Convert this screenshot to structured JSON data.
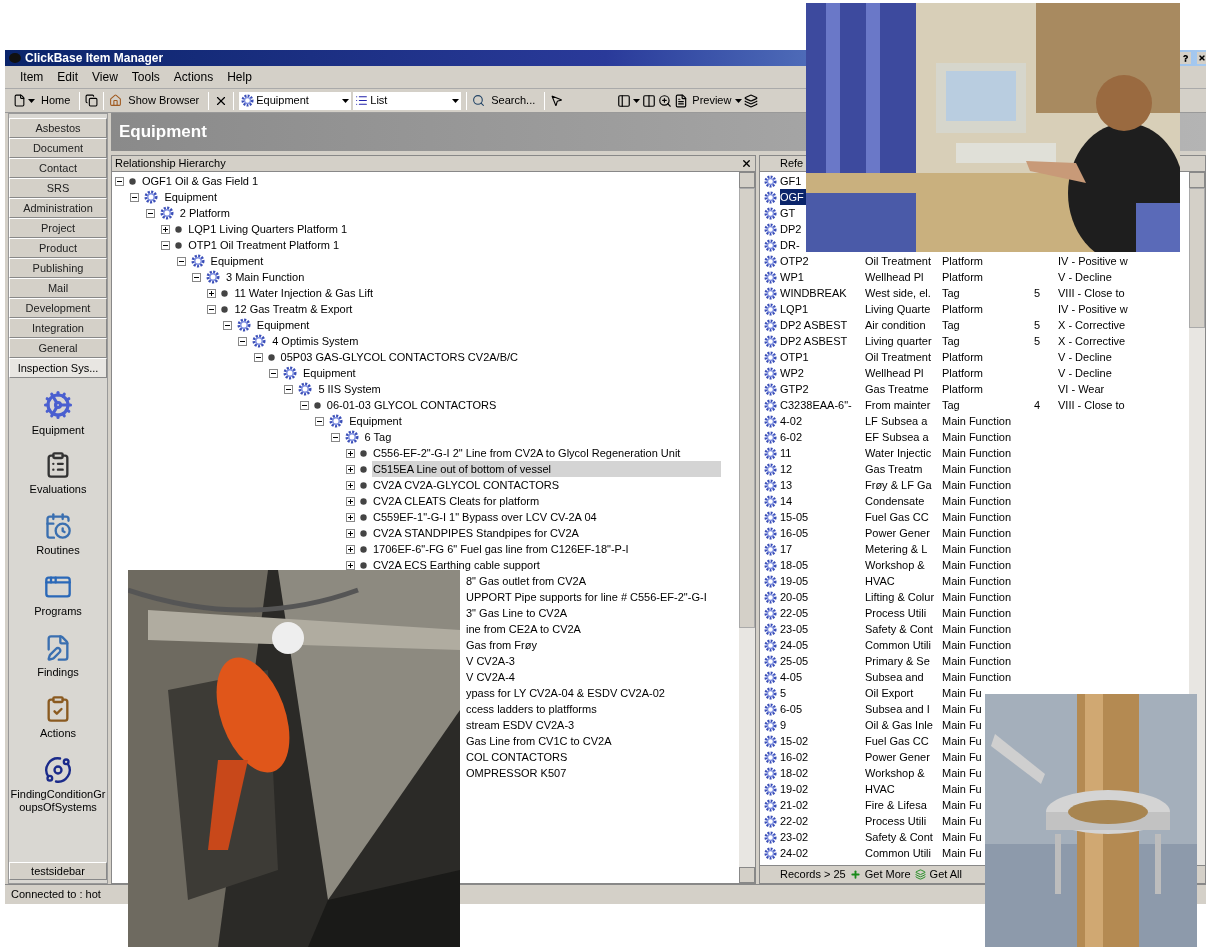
{
  "window": {
    "title": "ClickBase Item Manager"
  },
  "menu": [
    "Item",
    "Edit",
    "View",
    "Tools",
    "Actions",
    "Help"
  ],
  "toolbar": {
    "home": "Home",
    "show_browser": "Show Browser",
    "object_type": "Equipment",
    "view_mode": "List",
    "search": "Search...",
    "preview": "Preview"
  },
  "sidebar": {
    "categories": [
      {
        "label": "Asbestos",
        "selected": false
      },
      {
        "label": "Document",
        "selected": false
      },
      {
        "label": "Contact",
        "selected": false
      },
      {
        "label": "SRS",
        "selected": false
      },
      {
        "label": "Administration",
        "selected": false
      },
      {
        "label": "Project",
        "selected": false
      },
      {
        "label": "Product",
        "selected": false
      },
      {
        "label": "Publishing",
        "selected": false
      },
      {
        "label": "Mail",
        "selected": false
      },
      {
        "label": "Development",
        "selected": false
      },
      {
        "label": "Integration",
        "selected": false
      },
      {
        "label": "General",
        "selected": false
      },
      {
        "label": "Inspection Sys...",
        "selected": true
      }
    ],
    "items": [
      "Equipment",
      "Evaluations",
      "Routines",
      "Programs",
      "Findings",
      "Actions",
      "FindingConditionGroupsOfSystems"
    ],
    "footer": "testsidebar"
  },
  "header": "Equipment",
  "hierarchy": {
    "title": "Relationship Hierarchy",
    "tree": [
      {
        "kind": "item",
        "label": "OGF1 Oil & Gas Field 1",
        "expanded": true,
        "selected": false,
        "children": [
          {
            "kind": "group",
            "label": "Equipment",
            "expanded": true,
            "selected": false,
            "children": [
              {
                "kind": "group",
                "label": "2 Platform",
                "expanded": true,
                "selected": false,
                "children": [
                  {
                    "kind": "item",
                    "label": "LQP1 Living Quarters Platform 1",
                    "expanded": false,
                    "selected": false
                  },
                  {
                    "kind": "item",
                    "label": "OTP1 Oil Treatment Platform 1",
                    "expanded": true,
                    "selected": false,
                    "children": [
                      {
                        "kind": "group",
                        "label": "Equipment",
                        "expanded": true,
                        "selected": false,
                        "children": [
                          {
                            "kind": "group",
                            "label": "3 Main Function",
                            "expanded": true,
                            "selected": false,
                            "children": [
                              {
                                "kind": "item",
                                "label": "11 Water Injection & Gas Lift",
                                "expanded": false,
                                "selected": false
                              },
                              {
                                "kind": "item",
                                "label": "12 Gas Treatm  & Export",
                                "expanded": true,
                                "selected": false,
                                "children": [
                                  {
                                    "kind": "group",
                                    "label": "Equipment",
                                    "expanded": true,
                                    "selected": false,
                                    "children": [
                                      {
                                        "kind": "group",
                                        "label": "4 Optimis System",
                                        "expanded": true,
                                        "selected": false,
                                        "children": [
                                          {
                                            "kind": "item",
                                            "label": "05P03 GAS-GLYCOL CONTACTORS CV2A/B/C",
                                            "expanded": true,
                                            "selected": false,
                                            "children": [
                                              {
                                                "kind": "group",
                                                "label": "Equipment",
                                                "expanded": true,
                                                "selected": false,
                                                "children": [
                                                  {
                                                    "kind": "group",
                                                    "label": "5 IIS System",
                                                    "expanded": true,
                                                    "selected": false,
                                                    "children": [
                                                      {
                                                        "kind": "item",
                                                        "label": "06-01-03 GLYCOL CONTACTORS",
                                                        "expanded": true,
                                                        "selected": false,
                                                        "children": [
                                                          {
                                                            "kind": "group",
                                                            "label": "Equipment",
                                                            "expanded": true,
                                                            "selected": false,
                                                            "children": [
                                                              {
                                                                "kind": "group",
                                                                "label": "6 Tag",
                                                                "expanded": true,
                                                                "selected": false,
                                                                "children": [
                                                                  {
                                                                    "kind": "item",
                                                                    "label": "C556-EF-2\"-G-I 2\" Line from CV2A to Glycol Regeneration Unit",
                                                                    "expanded": false,
                                                                    "selected": false
                                                                  },
                                                                  {
                                                                    "kind": "item",
                                                                    "label": "C515EA Line out of bottom of vessel",
                                                                    "expanded": false,
                                                                    "selected": true
                                                                  },
                                                                  {
                                                                    "kind": "item",
                                                                    "label": "CV2A CV2A-GLYCOL CONTACTORS",
                                                                    "expanded": false,
                                                                    "selected": false
                                                                  },
                                                                  {
                                                                    "kind": "item",
                                                                    "label": "CV2A CLEATS Cleats for platform",
                                                                    "expanded": false,
                                                                    "selected": false
                                                                  },
                                                                  {
                                                                    "kind": "item",
                                                                    "label": "C559EF-1\"-G-I 1\" Bypass over LCV CV-2A 04",
                                                                    "expanded": false,
                                                                    "selected": false
                                                                  },
                                                                  {
                                                                    "kind": "item",
                                                                    "label": "CV2A STANDPIPES Standpipes for CV2A",
                                                                    "expanded": false,
                                                                    "selected": false
                                                                  },
                                                                  {
                                                                    "kind": "item",
                                                                    "label": "1706EF-6\"-FG  6\" Fuel gas line from C126EF-18\"-P-I",
                                                                    "expanded": false,
                                                                    "selected": false
                                                                  },
                                                                  {
                                                                    "kind": "item",
                                                                    "label": "CV2A ECS Earthing cable support",
                                                                    "expanded": false,
                                                                    "selected": false
                                                                  },
                                                                  {
                                                                    "kind": "partial",
                                                                    "label": "8\" Gas outlet from CV2A",
                                                                    "selected": false
                                                                  },
                                                                  {
                                                                    "kind": "partial",
                                                                    "label": "UPPORT Pipe supports for line # C556-EF-2\"-G-I",
                                                                    "selected": false
                                                                  },
                                                                  {
                                                                    "kind": "partial",
                                                                    "label": "3\" Gas Line to CV2A",
                                                                    "selected": false
                                                                  },
                                                                  {
                                                                    "kind": "partial",
                                                                    "label": "ine from CE2A to CV2A",
                                                                    "selected": false
                                                                  },
                                                                  {
                                                                    "kind": "partial",
                                                                    "label": "Gas from Frøy",
                                                                    "selected": false
                                                                  },
                                                                  {
                                                                    "kind": "partial",
                                                                    "label": "V CV2A-3",
                                                                    "selected": false
                                                                  },
                                                                  {
                                                                    "kind": "partial",
                                                                    "label": "V CV2A-4",
                                                                    "selected": false
                                                                  },
                                                                  {
                                                                    "kind": "partial",
                                                                    "label": "ypass for LY CV2A-04 & ESDV CV2A-02",
                                                                    "selected": false
                                                                  },
                                                                  {
                                                                    "kind": "partial",
                                                                    "label": "ccess ladders to platfforms",
                                                                    "selected": false
                                                                  },
                                                                  {
                                                                    "kind": "partial",
                                                                    "label": "stream ESDV CV2A-3",
                                                                    "selected": false
                                                                  },
                                                                  {
                                                                    "kind": "partial",
                                                                    "label": "Gas Line from CV1C to CV2A",
                                                                    "selected": false
                                                                  },
                                                                  {
                                                                    "kind": "partial",
                                                                    "label": "COL CONTACTORS",
                                                                    "selected": false
                                                                  },
                                                                  {
                                                                    "kind": "partial",
                                                                    "label": "OMPRESSOR K507",
                                                                    "selected": false
                                                                  }
                                                                ]
                                                              }
                                                            ]
                                                          }
                                                        ]
                                                      }
                                                    ]
                                                  }
                                                ]
                                              }
                                            ]
                                          }
                                        ]
                                      }
                                    ]
                                  }
                                ]
                              }
                            ]
                          }
                        ]
                      }
                    ]
                  }
                ]
              }
            ]
          }
        ]
      }
    ]
  },
  "records": {
    "header": "Refe",
    "rows": [
      {
        "ref": "GF1",
        "selected": false
      },
      {
        "ref": "OGF",
        "selected": true
      },
      {
        "ref": "GT",
        "selected": false
      },
      {
        "ref": "DP2",
        "selected": false
      },
      {
        "ref": "DR-",
        "selected": false
      },
      {
        "ref": "OTP2",
        "description": "Oil Treatment",
        "type": "Platform",
        "column_4": "",
        "column_5": "IV - Positive w",
        "selected": false
      },
      {
        "ref": "WP1",
        "description": "Wellhead Pl",
        "type": "Platform",
        "column_4": "",
        "column_5": "V - Decline",
        "selected": false
      },
      {
        "ref": "WINDBREAK",
        "description": "West side, el.",
        "type": "Tag",
        "column_4": "5",
        "column_5": "VIII - Close to",
        "selected": false
      },
      {
        "ref": "LQP1",
        "description": "Living Quarte",
        "type": "Platform",
        "column_4": "",
        "column_5": "IV - Positive w",
        "selected": false
      },
      {
        "ref": "DP2 ASBEST",
        "description": "Air condition",
        "type": "Tag",
        "column_4": "5",
        "column_5": "X - Corrective",
        "selected": false
      },
      {
        "ref": "DP2 ASBEST",
        "description": "Living quarter",
        "type": "Tag",
        "column_4": "5",
        "column_5": "X - Corrective",
        "selected": false
      },
      {
        "ref": "OTP1",
        "description": "Oil Treatment",
        "type": "Platform",
        "column_4": "",
        "column_5": "V - Decline",
        "selected": false
      },
      {
        "ref": "WP2",
        "description": "Wellhead Pl",
        "type": "Platform",
        "column_4": "",
        "column_5": "V - Decline",
        "selected": false
      },
      {
        "ref": "GTP2",
        "description": "Gas Treatme",
        "type": "Platform",
        "column_4": "",
        "column_5": "VI - Wear",
        "selected": false
      },
      {
        "ref": "C3238EAA-6\"-",
        "description": "From mainter",
        "type": "Tag",
        "column_4": "4",
        "column_5": "VIII - Close to",
        "selected": false
      },
      {
        "ref": "4-02",
        "description": "LF Subsea a",
        "type": "Main Function",
        "selected": false
      },
      {
        "ref": "6-02",
        "description": "EF Subsea a",
        "type": "Main Function",
        "selected": false
      },
      {
        "ref": "11",
        "description": "Water Injectic",
        "type": "Main Function",
        "selected": false
      },
      {
        "ref": "12",
        "description": "Gas Treatm",
        "type": "Main Function",
        "selected": false
      },
      {
        "ref": "13",
        "description": "Frøy & LF Ga",
        "type": "Main Function",
        "selected": false
      },
      {
        "ref": "14",
        "description": "Condensate",
        "type": "Main Function",
        "selected": false
      },
      {
        "ref": "15-05",
        "description": "Fuel Gas CC",
        "type": "Main Function",
        "selected": false
      },
      {
        "ref": "16-05",
        "description": "Power Gener",
        "type": "Main Function",
        "selected": false
      },
      {
        "ref": "17",
        "description": "Metering & L",
        "type": "Main Function",
        "selected": false
      },
      {
        "ref": "18-05",
        "description": "Workshop &",
        "type": "Main Function",
        "selected": false
      },
      {
        "ref": "19-05",
        "description": "HVAC",
        "type": "Main Function",
        "selected": false
      },
      {
        "ref": "20-05",
        "description": "Lifting & Colur",
        "type": "Main Function",
        "selected": false
      },
      {
        "ref": "22-05",
        "description": "Process Utili",
        "type": "Main Function",
        "selected": false
      },
      {
        "ref": "23-05",
        "description": "Safety & Cont",
        "type": "Main Function",
        "selected": false
      },
      {
        "ref": "24-05",
        "description": "Common Utili",
        "type": "Main Function",
        "selected": false
      },
      {
        "ref": "25-05",
        "description": "Primary & Se",
        "type": "Main Function",
        "selected": false
      },
      {
        "ref": "4-05",
        "description": "Subsea and",
        "type": "Main Function",
        "selected": false
      },
      {
        "ref": "5",
        "description": "Oil Export",
        "type": "Main Fu",
        "selected": false
      },
      {
        "ref": "6-05",
        "description": "Subsea and I",
        "type": "Main Fu",
        "selected": false
      },
      {
        "ref": "9",
        "description": "Oil & Gas Inle",
        "type": "Main Fu",
        "selected": false
      },
      {
        "ref": "15-02",
        "description": "Fuel Gas CC",
        "type": "Main Fu",
        "selected": false
      },
      {
        "ref": "16-02",
        "description": "Power Gener",
        "type": "Main Fu",
        "selected": false
      },
      {
        "ref": "18-02",
        "description": "Workshop &",
        "type": "Main Fu",
        "selected": false
      },
      {
        "ref": "19-02",
        "description": "HVAC",
        "type": "Main Fu",
        "selected": false
      },
      {
        "ref": "21-02",
        "description": "Fire & Lifesa",
        "type": "Main Fu",
        "selected": false
      },
      {
        "ref": "22-02",
        "description": "Process Utili",
        "type": "Main Fu",
        "selected": false
      },
      {
        "ref": "23-02",
        "description": "Safety & Cont",
        "type": "Main Fu",
        "selected": false
      },
      {
        "ref": "24-02",
        "description": "Common Utili",
        "type": "Main Fu",
        "selected": false
      }
    ],
    "count": "Records > 25",
    "get_more": "Get More",
    "get_all": "Get All"
  },
  "status_bar": "Connected to : hot",
  "overlays": [
    {
      "kind": "picture"
    },
    {
      "kind": "picture"
    },
    {
      "kind": "picture"
    }
  ]
}
